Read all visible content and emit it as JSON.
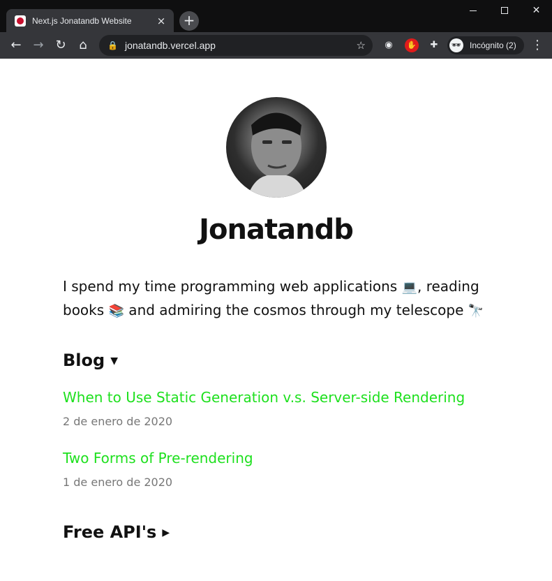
{
  "browser": {
    "tab": {
      "title": "Next.js Jonatandb Website",
      "close_icon": "×"
    },
    "new_tab_icon": "+",
    "window": {
      "minimize": "",
      "maximize": "",
      "close": "✕"
    },
    "nav": {
      "back": "←",
      "forward": "→",
      "reload": "↻",
      "home": "⌂"
    },
    "address": {
      "url": "jonatandb.vercel.app",
      "lock": "🔒",
      "star": "☆"
    },
    "extensions": [
      "spy-extension-icon",
      "adblock-hand-icon",
      "puzzle-extensions-icon"
    ],
    "ext_glyphs": {
      "one": "◉",
      "two": "✋",
      "three": "✚"
    },
    "profile": {
      "label": "Incógnito (2)",
      "icon": "🕶"
    },
    "menu": "⋮"
  },
  "page": {
    "title": "Jonatandb",
    "intro": {
      "line1_a": "I spend my time programming web applications ",
      "emoji_laptop": "💻",
      "line1_b": ", reading",
      "line2_a": "books ",
      "emoji_books": "📚",
      "line2_b": " and admiring the cosmos through my telescope ",
      "emoji_telescope": "🔭"
    },
    "blog": {
      "heading": "Blog",
      "arrow": "▼",
      "posts": [
        {
          "title": "When to Use Static Generation v.s. Server-side Rendering",
          "date": "2 de enero de 2020"
        },
        {
          "title": "Two Forms of Pre-rendering",
          "date": "1 de enero de 2020"
        }
      ]
    },
    "apis": {
      "heading": "Free API's",
      "arrow": "▶"
    }
  },
  "colors": {
    "link": "#1ee01e",
    "date": "#777777",
    "chrome_dark": "#202124"
  }
}
